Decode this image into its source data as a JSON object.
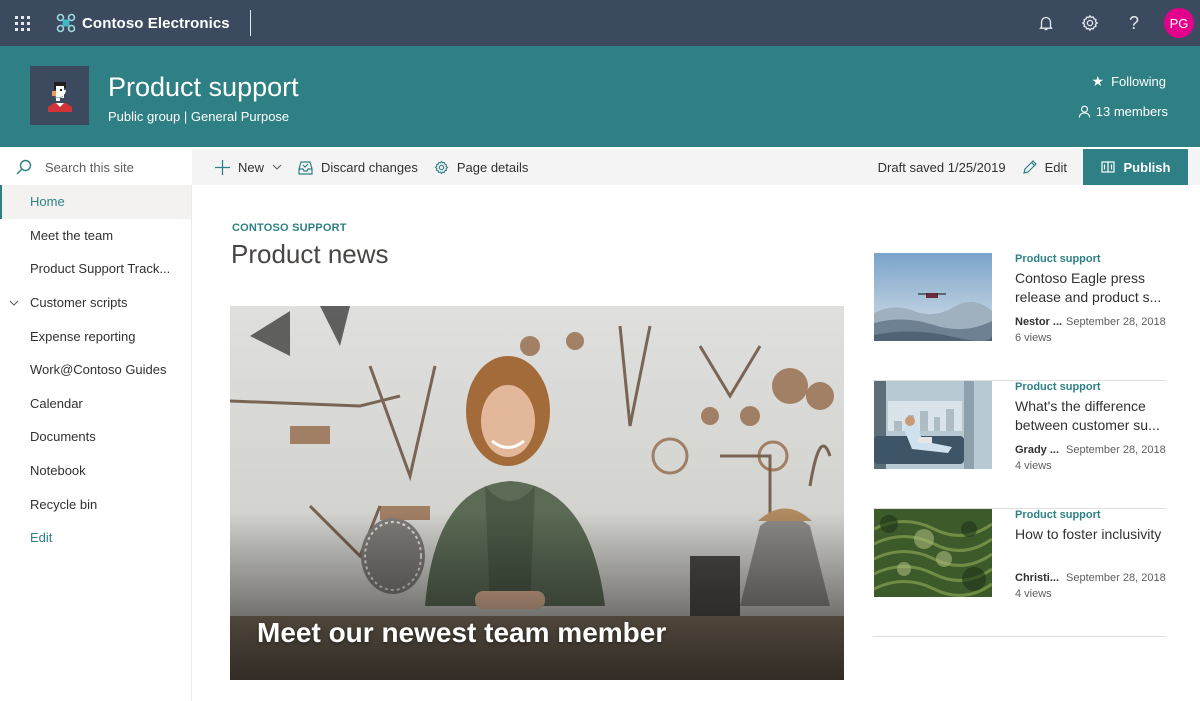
{
  "suitebar": {
    "app_name": "Contoso Electronics",
    "avatar_initials": "PG",
    "avatar_color": "#e3008c",
    "icons": [
      "waffle-icon",
      "bell-icon",
      "gear-icon",
      "help-icon"
    ]
  },
  "site": {
    "title": "Product support",
    "subtitle": "Public group | General Purpose",
    "following_label": "Following",
    "members_label": "13 members",
    "brand_color": "#2e8085"
  },
  "search": {
    "placeholder": "Search this site"
  },
  "commandbar": {
    "new_label": "New",
    "discard_label": "Discard changes",
    "page_details_label": "Page details",
    "draft_status": "Draft saved 1/25/2019",
    "edit_label": "Edit",
    "publish_label": "Publish"
  },
  "nav": {
    "items": [
      {
        "label": "Home",
        "active": true
      },
      {
        "label": "Meet the team"
      },
      {
        "label": "Product Support Track..."
      },
      {
        "label": "Customer scripts",
        "expandable": true
      },
      {
        "label": "Expense reporting"
      },
      {
        "label": "Work@Contoso Guides"
      },
      {
        "label": "Calendar"
      },
      {
        "label": "Documents"
      },
      {
        "label": "Notebook"
      },
      {
        "label": "Recycle bin"
      }
    ],
    "edit_label": "Edit"
  },
  "news": {
    "eyebrow": "CONTOSO SUPPORT",
    "title": "Product news",
    "hero": {
      "title": "Meet our newest team member"
    },
    "items": [
      {
        "category": "Product support",
        "title": "Contoso Eagle press release and product s...",
        "author": "Nestor ...",
        "date": "September 28, 2018",
        "views": "6 views"
      },
      {
        "category": "Product support",
        "title": "What's the difference between customer su...",
        "author": "Grady ...",
        "date": "September 28, 2018",
        "views": "4 views"
      },
      {
        "category": "Product support",
        "title": "How to foster inclusivity",
        "author": "Christi...",
        "date": "September 28, 2018",
        "views": "4 views"
      }
    ]
  }
}
